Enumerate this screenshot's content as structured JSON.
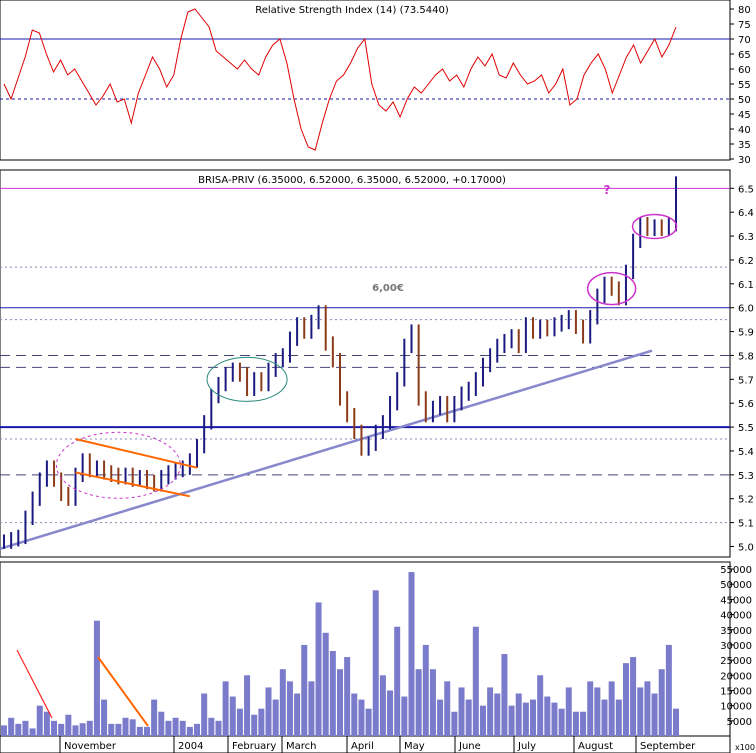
{
  "chart_data": [
    {
      "type": "line",
      "title": "Relative Strength Index (14) (73.5440)",
      "yticks": [
        30,
        35,
        40,
        45,
        50,
        55,
        60,
        65,
        70,
        75,
        80
      ],
      "ylim": [
        29,
        82
      ],
      "reference_lines": [
        70,
        50
      ],
      "series": [
        {
          "values": [
            55,
            50,
            57,
            64,
            73,
            72,
            65,
            59,
            63,
            58,
            60,
            56,
            52,
            48,
            51,
            55,
            49,
            50,
            42,
            52,
            58,
            64,
            60,
            54,
            58,
            70,
            79,
            80,
            77,
            74,
            66,
            64,
            62,
            60,
            63,
            60,
            58,
            64,
            68,
            70,
            62,
            50,
            40,
            34,
            33,
            42,
            50,
            56,
            58,
            62,
            67,
            70,
            55,
            48,
            46,
            49,
            44,
            50,
            54,
            52,
            55,
            58,
            60,
            56,
            58,
            54,
            60,
            64,
            61,
            65,
            58,
            57,
            62,
            58,
            55,
            56,
            58,
            52,
            55,
            60,
            48,
            50,
            58,
            62,
            65,
            60,
            52,
            58,
            64,
            68,
            62,
            66,
            70,
            64,
            68,
            74
          ]
        }
      ]
    },
    {
      "type": "candlestick",
      "title": "BRISA-PRIV (6.35000, 6.52000, 6.35000, 6.52000, +0.17000)",
      "yticks": [
        5.0,
        5.1,
        5.2,
        5.3,
        5.4,
        5.5,
        5.6,
        5.7,
        5.8,
        5.9,
        6.0,
        6.1,
        6.2,
        6.3,
        6.4,
        6.5
      ],
      "ylim": [
        4.96,
        6.56
      ],
      "annotations": [
        "6,00€",
        "?"
      ],
      "resistance_levels": [
        6.5,
        6.0,
        5.5
      ],
      "values": [
        5.02,
        5.03,
        5.04,
        5.12,
        5.2,
        5.28,
        5.33,
        5.28,
        5.22,
        5.2,
        5.3,
        5.36,
        5.32,
        5.33,
        5.31,
        5.3,
        5.29,
        5.3,
        5.28,
        5.29,
        5.27,
        5.26,
        5.29,
        5.31,
        5.32,
        5.33,
        5.36,
        5.42,
        5.52,
        5.63,
        5.68,
        5.72,
        5.74,
        5.72,
        5.66,
        5.7,
        5.68,
        5.74,
        5.78,
        5.8,
        5.87,
        5.93,
        5.9,
        5.94,
        5.98,
        5.85,
        5.78,
        5.62,
        5.55,
        5.48,
        5.41,
        5.43,
        5.48,
        5.52,
        5.6,
        5.7,
        5.84,
        5.9,
        5.62,
        5.55,
        5.58,
        5.6,
        5.55,
        5.6,
        5.64,
        5.66,
        5.7,
        5.76,
        5.8,
        5.84,
        5.86,
        5.88,
        5.84,
        5.93,
        5.9,
        5.92,
        5.91,
        5.93,
        5.94,
        5.96,
        5.92,
        5.88,
        5.96,
        6.05,
        6.1,
        6.08,
        6.04,
        6.15,
        6.28,
        6.35,
        6.33,
        6.34,
        6.33,
        6.35,
        6.52
      ]
    },
    {
      "type": "bar",
      "title": "",
      "ylabel": "x100",
      "yticks": [
        5000,
        10000,
        15000,
        20000,
        25000,
        30000,
        35000,
        40000,
        45000,
        50000,
        55000
      ],
      "ylim": [
        0,
        56000
      ],
      "categories": [
        "November",
        "2004",
        "February",
        "March",
        "April",
        "May",
        "June",
        "July",
        "August",
        "September"
      ],
      "values": [
        3500,
        6000,
        4000,
        5000,
        2500,
        10000,
        8000,
        5000,
        4000,
        7000,
        3500,
        4200,
        5000,
        38000,
        12000,
        4000,
        4000,
        6000,
        5500,
        3000,
        3000,
        12000,
        8000,
        5000,
        6000,
        5000,
        3000,
        4000,
        14000,
        6000,
        5000,
        18000,
        13000,
        9000,
        20000,
        7000,
        9000,
        16000,
        12000,
        22000,
        18000,
        14000,
        30000,
        18000,
        44000,
        34000,
        28000,
        22000,
        26000,
        14000,
        12000,
        9000,
        48000,
        20000,
        15000,
        36000,
        13000,
        54000,
        22000,
        30000,
        22000,
        12000,
        18000,
        8000,
        16000,
        12000,
        36000,
        10000,
        16000,
        14000,
        27000,
        10000,
        14000,
        11000,
        12000,
        20000,
        13000,
        11000,
        9000,
        16000,
        8000,
        8000,
        18000,
        16000,
        12000,
        18000,
        12000,
        24000,
        26000,
        16000,
        18000,
        14000,
        22000,
        30000,
        9000
      ]
    }
  ],
  "colors": {
    "rsi_line": "#e00000",
    "price_up": "#1a1a80",
    "price_down": "#8b3a1a",
    "volume": "#7b7bcc",
    "reference_line": "#1a1aaa",
    "target_line": "#cc33cc",
    "trendline": "#8888cc",
    "pattern_line": "#ff6600",
    "annotation": "#cc33cc"
  }
}
